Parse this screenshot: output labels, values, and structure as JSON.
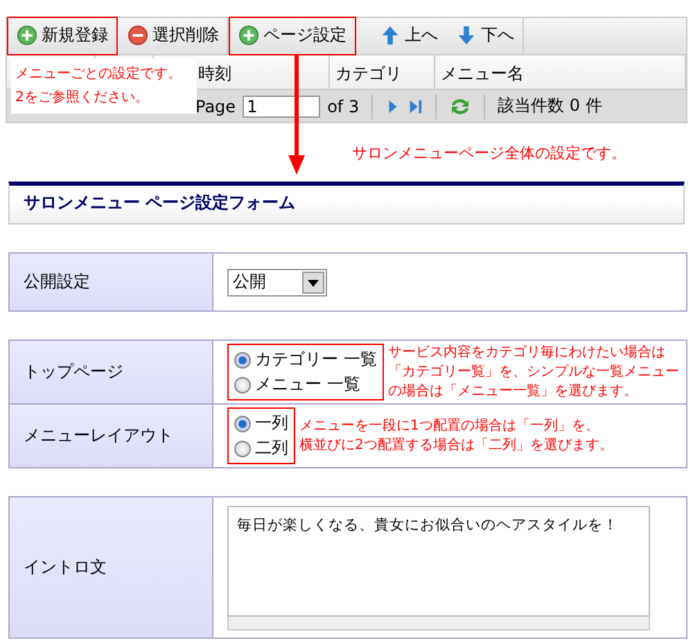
{
  "toolbar": {
    "buttons": [
      {
        "label": "新規登録",
        "kind": "add",
        "highlighted": true
      },
      {
        "label": "選択削除",
        "kind": "delete",
        "highlighted": false
      },
      {
        "label": "ページ設定",
        "kind": "add",
        "highlighted": true
      },
      {
        "label": "上へ",
        "kind": "up",
        "highlighted": false
      },
      {
        "label": "下へ",
        "kind": "down",
        "highlighted": false
      }
    ]
  },
  "grid": {
    "columns": [
      "時刻",
      "カテゴリ",
      "メニュー名"
    ]
  },
  "pager": {
    "page_label": "Page",
    "page": "1",
    "of": "of 3",
    "count": "該当件数 0 件"
  },
  "callout": [
    "メニューごとの設定です。",
    "2をご参照ください。"
  ],
  "arrow_note": "サロンメニューページ全体の設定です。",
  "form": {
    "title": "サロンメニュー ページ設定フォーム",
    "sections": [
      {
        "rows": [
          {
            "label": "公開設定",
            "kind": "select",
            "value": "公開"
          }
        ]
      },
      {
        "rows": [
          {
            "label": "トップページ",
            "kind": "radio",
            "highlighted": true,
            "options": [
              {
                "label": "カテゴリー 一覧",
                "selected": true
              },
              {
                "label": "メニュー 一覧",
                "selected": false
              }
            ],
            "note": [
              "サービス内容をカテゴリ毎にわけたい場合は",
              "「カテゴリー覧」を、シンプルな一覧メニュー",
              "の場合は「メニュー一覧」を選びます。"
            ]
          },
          {
            "label": "メニューレイアウト",
            "kind": "radio",
            "highlighted": true,
            "options": [
              {
                "label": "一列",
                "selected": true
              },
              {
                "label": "二列",
                "selected": false
              }
            ],
            "note": [
              "メニューを一段に1つ配置の場合は「一列」を、",
              "横並びに2つ配置する場合は「二列」を選びます。"
            ]
          }
        ]
      },
      {
        "rows": [
          {
            "label": "イントロ文",
            "kind": "textarea",
            "value": "毎日が楽しくなる、貴女にお似合いのヘアスタイルを！"
          }
        ]
      }
    ]
  }
}
